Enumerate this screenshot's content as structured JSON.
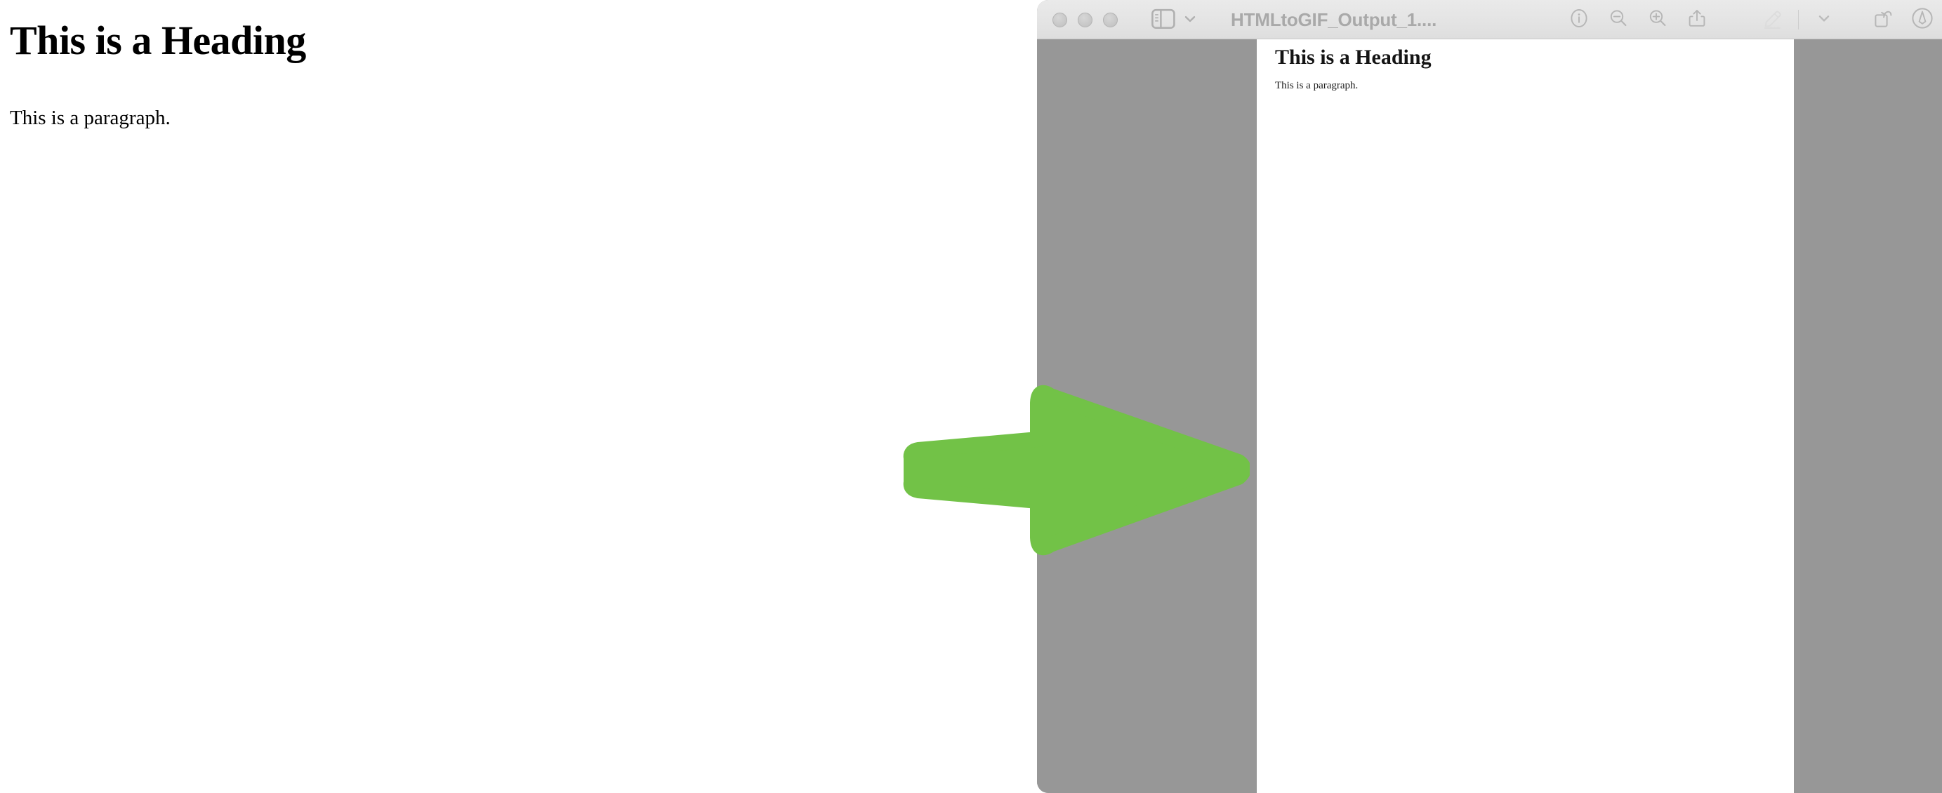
{
  "browser_page": {
    "heading": "This is a Heading",
    "paragraph": "This is a paragraph."
  },
  "preview_window": {
    "title": "HTMLtoGIF_Output_1....",
    "traffic_lights": [
      {
        "name": "close",
        "state": "inactive"
      },
      {
        "name": "minimize",
        "state": "inactive"
      },
      {
        "name": "zoom",
        "state": "inactive"
      }
    ],
    "sidebar_toggle": {
      "icon": "sidebar-icon",
      "dropdown_icon": "chevron-down-icon"
    },
    "toolbar_actions": [
      {
        "name": "info",
        "icon": "info-circle-icon",
        "enabled": true
      },
      {
        "name": "zoom-out",
        "icon": "magnifier-minus-icon",
        "enabled": true
      },
      {
        "name": "zoom-in",
        "icon": "magnifier-plus-icon",
        "enabled": true
      },
      {
        "name": "share",
        "icon": "share-icon",
        "enabled": true
      },
      {
        "name": "markup",
        "icon": "pencil-markup-icon",
        "enabled": false
      },
      {
        "name": "markup-options",
        "icon": "chevron-down-icon",
        "enabled": true
      },
      {
        "name": "rotate-left",
        "icon": "rotate-left-icon",
        "enabled": true
      },
      {
        "name": "annotate",
        "icon": "annotate-pen-circle-icon",
        "enabled": true
      }
    ],
    "document": {
      "heading": "This is a Heading",
      "paragraph": "This is a paragraph."
    }
  },
  "annotation": {
    "arrow": {
      "name": "green-arrow-pointing-right",
      "direction": "right",
      "color": "#72c247"
    }
  },
  "colors": {
    "arrow_green": "#72c247",
    "preview_backdrop_gray": "#979797",
    "toolbar_gray": "#e4e4e4",
    "toolbar_icon_gray": "#b4b4b4",
    "title_gray": "#a9a9a9",
    "page_white": "#ffffff"
  }
}
